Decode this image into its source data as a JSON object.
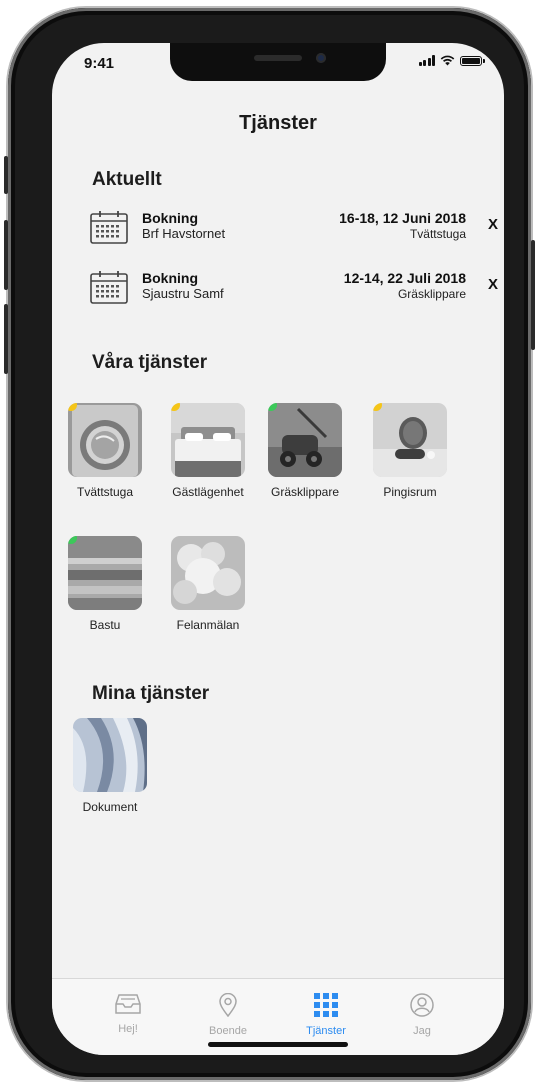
{
  "status": {
    "time": "9:41"
  },
  "page": {
    "title": "Tjänster"
  },
  "aktuellt": {
    "heading": "Aktuellt",
    "bookings": [
      {
        "title": "Bokning",
        "place": "Brf Havstornet",
        "date": "16-18, 12 Juni 2018",
        "service": "Tvättstuga",
        "remove_label": "X"
      },
      {
        "title": "Bokning",
        "place": "Sjaustru Samf",
        "date": "12-14, 22 Juli 2018",
        "service": "Gräsklippare",
        "remove_label": "X"
      }
    ]
  },
  "vara_tjanster": {
    "heading": "Våra tjänster",
    "items": [
      {
        "label": "Tvättstuga",
        "icon": "washing-machine-photo",
        "status_color": "#f5c518"
      },
      {
        "label": "Gästlägenhet",
        "icon": "guest-room-photo",
        "status_color": "#f5c518"
      },
      {
        "label": "Gräsklippare",
        "icon": "lawn-mower-photo",
        "status_color": "#3cc95a"
      },
      {
        "label": "Pingisrum",
        "icon": "ping-pong-photo",
        "status_color": "#f5c518"
      },
      {
        "label": "Bastu",
        "icon": "sauna-photo",
        "status_color": "#3cc95a"
      },
      {
        "label": "Felanmälan",
        "icon": "clouds-photo",
        "status_color": null
      }
    ]
  },
  "mina_tjanster": {
    "heading": "Mina tjänster",
    "items": [
      {
        "label": "Dokument",
        "icon": "fabric-photo"
      }
    ]
  },
  "tabbar": {
    "accent": "#2d8cf0",
    "tabs": [
      {
        "label": "Hej!",
        "icon": "inbox-icon"
      },
      {
        "label": "Boende",
        "icon": "location-pin-icon"
      },
      {
        "label": "Tjänster",
        "icon": "grid-icon",
        "active": true
      },
      {
        "label": "Jag",
        "icon": "user-icon"
      }
    ]
  }
}
